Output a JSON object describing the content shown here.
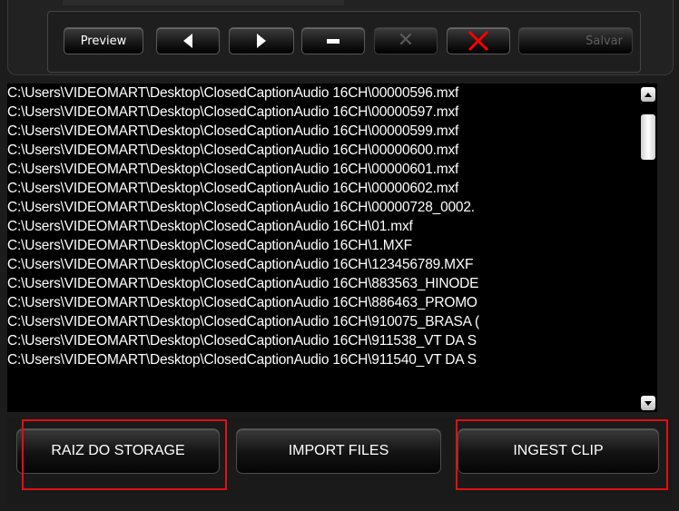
{
  "toolbar": {
    "preview_label": "Preview",
    "prev_icon": "triangle-left-icon",
    "next_icon": "triangle-right-icon",
    "remove_icon": "minus-icon",
    "clear_icon": "x-icon",
    "delete_icon": "red-x-icon",
    "save_label": "Salvar",
    "colors": {
      "red_x": "#ff0000",
      "disabled_x": "#5a5a5a"
    }
  },
  "files": [
    "C:\\Users\\VIDEOMART\\Desktop\\ClosedCaptionAudio 16CH\\00000596.mxf",
    "C:\\Users\\VIDEOMART\\Desktop\\ClosedCaptionAudio 16CH\\00000597.mxf",
    "C:\\Users\\VIDEOMART\\Desktop\\ClosedCaptionAudio 16CH\\00000599.mxf",
    "C:\\Users\\VIDEOMART\\Desktop\\ClosedCaptionAudio 16CH\\00000600.mxf",
    "C:\\Users\\VIDEOMART\\Desktop\\ClosedCaptionAudio 16CH\\00000601.mxf",
    "C:\\Users\\VIDEOMART\\Desktop\\ClosedCaptionAudio 16CH\\00000602.mxf",
    "C:\\Users\\VIDEOMART\\Desktop\\ClosedCaptionAudio 16CH\\00000728_0002.",
    "C:\\Users\\VIDEOMART\\Desktop\\ClosedCaptionAudio 16CH\\01.mxf",
    "C:\\Users\\VIDEOMART\\Desktop\\ClosedCaptionAudio 16CH\\1.MXF",
    "C:\\Users\\VIDEOMART\\Desktop\\ClosedCaptionAudio 16CH\\123456789.MXF",
    "C:\\Users\\VIDEOMART\\Desktop\\ClosedCaptionAudio 16CH\\883563_HINODE",
    "C:\\Users\\VIDEOMART\\Desktop\\ClosedCaptionAudio 16CH\\886463_PROMO",
    "C:\\Users\\VIDEOMART\\Desktop\\ClosedCaptionAudio 16CH\\910075_BRASA (",
    "C:\\Users\\VIDEOMART\\Desktop\\ClosedCaptionAudio 16CH\\911538_VT DA S",
    "C:\\Users\\VIDEOMART\\Desktop\\ClosedCaptionAudio 16CH\\911540_VT DA S"
  ],
  "bottom": {
    "raiz_label": "RAIZ DO STORAGE",
    "import_label": "IMPORT FILES",
    "ingest_label": "INGEST CLIP"
  },
  "highlight_color": "#e01010"
}
